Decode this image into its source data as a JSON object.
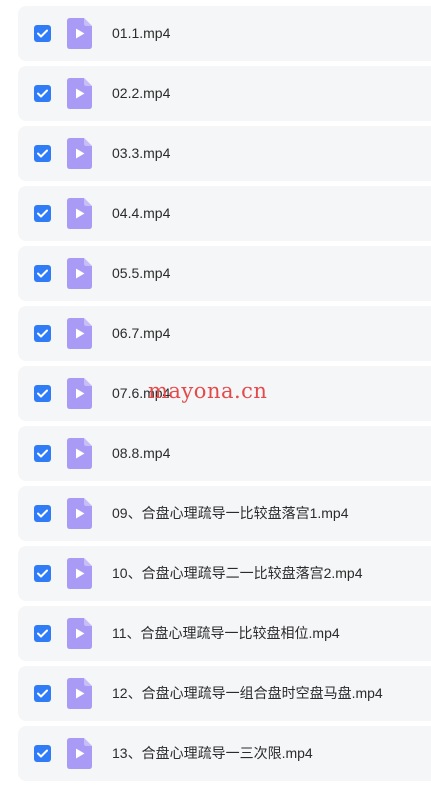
{
  "colors": {
    "checkbox": "#2f7cf6",
    "file_icon": "#a89af5",
    "row_background": "#f5f6f8",
    "watermark": "#e54a4a"
  },
  "files": [
    {
      "name": "01.1.mp4",
      "checked": true,
      "icon": "video-file-icon"
    },
    {
      "name": "02.2.mp4",
      "checked": true,
      "icon": "video-file-icon"
    },
    {
      "name": "03.3.mp4",
      "checked": true,
      "icon": "video-file-icon"
    },
    {
      "name": "04.4.mp4",
      "checked": true,
      "icon": "video-file-icon"
    },
    {
      "name": "05.5.mp4",
      "checked": true,
      "icon": "video-file-icon"
    },
    {
      "name": "06.7.mp4",
      "checked": true,
      "icon": "video-file-icon"
    },
    {
      "name": "07.6.mp4",
      "checked": true,
      "icon": "video-file-icon"
    },
    {
      "name": "08.8.mp4",
      "checked": true,
      "icon": "video-file-icon"
    },
    {
      "name": "09、合盘心理疏导一比较盘落宫1.mp4",
      "checked": true,
      "icon": "video-file-icon"
    },
    {
      "name": "10、合盘心理疏导二一比较盘落宫2.mp4",
      "checked": true,
      "icon": "video-file-icon"
    },
    {
      "name": "11、合盘心理疏导一比较盘相位.mp4",
      "checked": true,
      "icon": "video-file-icon"
    },
    {
      "name": "12、合盘心理疏导一组合盘时空盘马盘.mp4",
      "checked": true,
      "icon": "video-file-icon"
    },
    {
      "name": "13、合盘心理疏导一三次限.mp4",
      "checked": true,
      "icon": "video-file-icon"
    }
  ],
  "watermark": "mayona.cn"
}
